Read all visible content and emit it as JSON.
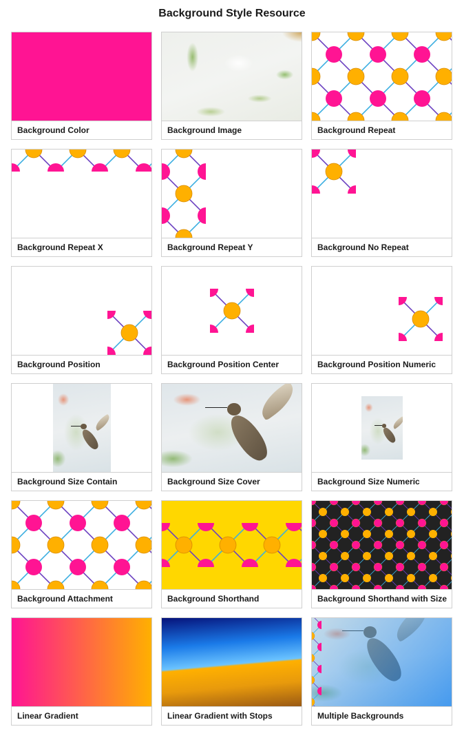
{
  "page": {
    "title": "Background Style Resource"
  },
  "colors": {
    "pink": "#ff1493",
    "orange": "#ffb000",
    "purple": "#6a3fc0",
    "cyan": "#3aaee0",
    "yellow": "#ffd700",
    "dark": "#222222",
    "border": "#cfcfcf"
  },
  "cards": [
    {
      "label": "Background Color",
      "effect": "color"
    },
    {
      "label": "Background Image",
      "effect": "image"
    },
    {
      "label": "Background Repeat",
      "effect": "repeat"
    },
    {
      "label": "Background Repeat X",
      "effect": "repeat-x"
    },
    {
      "label": "Background Repeat Y",
      "effect": "repeat-y"
    },
    {
      "label": "Background No Repeat",
      "effect": "no-repeat"
    },
    {
      "label": "Background Position",
      "effect": "position"
    },
    {
      "label": "Background Position Center",
      "effect": "position-center"
    },
    {
      "label": "Background Position Numeric",
      "effect": "position-numeric"
    },
    {
      "label": "Background Size Contain",
      "effect": "size-contain"
    },
    {
      "label": "Background Size Cover",
      "effect": "size-cover"
    },
    {
      "label": "Background Size Numeric",
      "effect": "size-numeric"
    },
    {
      "label": "Background Attachment",
      "effect": "attachment"
    },
    {
      "label": "Background Shorthand",
      "effect": "shorthand"
    },
    {
      "label": "Background Shorthand with Size",
      "effect": "shorthand-size"
    },
    {
      "label": "Linear Gradient",
      "effect": "linear-gradient"
    },
    {
      "label": "Linear Gradient with Stops",
      "effect": "gradient-stops"
    },
    {
      "label": "Multiple Backgrounds",
      "effect": "multiple"
    }
  ]
}
